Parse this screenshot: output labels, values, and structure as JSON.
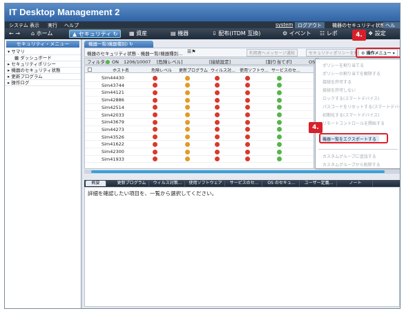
{
  "app": {
    "title": "IT Desktop Management 2"
  },
  "menubar": {
    "items": [
      "システム",
      "表示",
      "実行",
      "ヘルプ"
    ],
    "user": "system",
    "logout": "ログアウト",
    "status": "機器のセキュリティ状態",
    "help": "ヘルプ"
  },
  "toolbar": {
    "home": "ホーム",
    "security": "セキュリティ",
    "assets": "資産",
    "devices": "機器",
    "distribution": "配布(ITDM 互換)",
    "events": "イベント",
    "reports": "レポ",
    "settings": "設定"
  },
  "sidebar": {
    "header": "セキュリティ・メニュー",
    "items": [
      {
        "label": "サマリ",
        "level": 0
      },
      {
        "label": "ダッシュボード",
        "level": 1
      },
      {
        "label": "セキュリティポリシー",
        "level": 0
      },
      {
        "label": "機器のセキュリティ状態",
        "level": 0
      },
      {
        "label": "更新プログラム",
        "level": 0
      },
      {
        "label": "操作ログ",
        "level": 0
      }
    ]
  },
  "main": {
    "tab": "機器一覧(機器種別)",
    "breadcrumb": "機器のセキュリティ状態 - 機器一覧(機器種別...",
    "notify_btn": "利用者へメッセージ通知",
    "policy_btn": "セキュリティポリシーを割り当て",
    "ops_menu": "操作メニュー"
  },
  "filter": {
    "label": "フィルタ:",
    "state": "ON",
    "count": "1206/10007",
    "risk": "[危険レベル]",
    "connection": "[接続設定]",
    "assigned": "[割り当てポ]",
    "os": "OS"
  },
  "grid": {
    "headers": [
      "ホスト名",
      "危険レベル",
      "更新プログラム",
      "ウィルス対...",
      "使用ソフトウ...",
      "サービスのセ..."
    ],
    "rows": [
      {
        "host": "Sim44430",
        "icons": [
          "red",
          "amb",
          "red",
          "red",
          "grn"
        ]
      },
      {
        "host": "Sim43744",
        "icons": [
          "red",
          "amb",
          "red",
          "red",
          "grn"
        ]
      },
      {
        "host": "Sim44121",
        "icons": [
          "red",
          "amb",
          "red",
          "red",
          "grn"
        ]
      },
      {
        "host": "Sim42886",
        "icons": [
          "red",
          "amb",
          "red",
          "red",
          "grn"
        ]
      },
      {
        "host": "Sim42514",
        "icons": [
          "red",
          "amb",
          "red",
          "red",
          "grn"
        ]
      },
      {
        "host": "Sim42033",
        "icons": [
          "red",
          "amb",
          "red",
          "red",
          "grn"
        ]
      },
      {
        "host": "Sim43679",
        "icons": [
          "red",
          "amb",
          "red",
          "red",
          "grn"
        ]
      },
      {
        "host": "Sim44273",
        "icons": [
          "red",
          "amb",
          "red",
          "red",
          "grn"
        ]
      },
      {
        "host": "Sim43526",
        "icons": [
          "red",
          "amb",
          "red",
          "red",
          "grn"
        ]
      },
      {
        "host": "Sim41622",
        "icons": [
          "red",
          "amb",
          "red",
          "red",
          "grn"
        ]
      },
      {
        "host": "Sim42300",
        "icons": [
          "red",
          "amb",
          "red",
          "red",
          "grn"
        ]
      },
      {
        "host": "Sim41933",
        "icons": [
          "red",
          "amb",
          "red",
          "red",
          "grn"
        ]
      }
    ]
  },
  "dropdown": {
    "items": [
      {
        "label": "ポリシーを割り当てる",
        "enabled": false
      },
      {
        "label": "ポリシーの割り当てを解除する",
        "enabled": false
      },
      {
        "label": "接続を許可する",
        "enabled": false
      },
      {
        "label": "接続を許可しない",
        "enabled": false
      },
      {
        "label": "ロックする(スマートデバイス)",
        "enabled": false
      },
      {
        "label": "パスコードをリセットする(スマートデバイス)",
        "enabled": false
      },
      {
        "label": "初期化する(スマートデバイス)",
        "enabled": false
      },
      {
        "label": "リモートコントロールを開始する",
        "enabled": false
      },
      {
        "label": "機器一覧をエクスポートする",
        "enabled": true
      },
      {
        "label": "カスタムグループに追加する",
        "enabled": false
      },
      {
        "label": "カスタムグループから削除する",
        "enabled": false
      }
    ]
  },
  "callouts": {
    "badge": "4."
  },
  "detail": {
    "tabs": [
      "概要",
      "更新プログラム",
      "ウィルス対策...",
      "使用ソフトウェア",
      "サービスのセ...",
      "OS のセキュ...",
      "ユーザー定義...",
      "ノート"
    ],
    "message": "詳細を確認したい項目を、一覧から選択してください。"
  },
  "colors": {
    "accent": "#3b72b4",
    "callout": "#d8202a",
    "danger": "#d83a2a",
    "warning": "#e39a24",
    "ok": "#55b54a"
  }
}
